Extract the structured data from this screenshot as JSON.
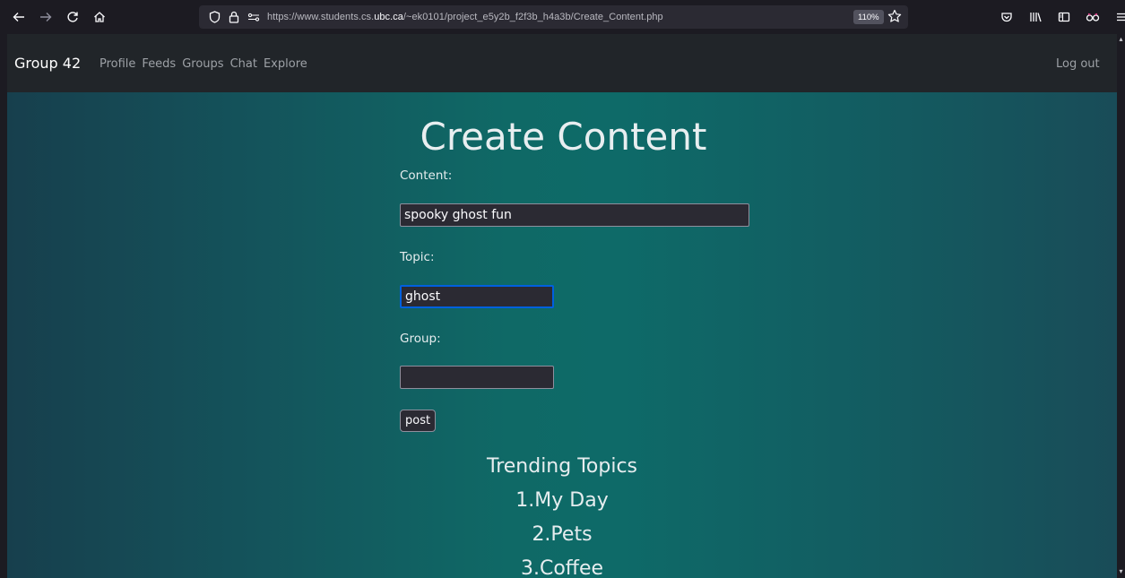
{
  "browser": {
    "url_prefix": "https://www.students.cs.",
    "url_domain": "ubc.ca",
    "url_suffix": "/~ek0101/project_e5y2b_f2f3b_h4a3b/Create_Content.php",
    "zoom": "110%"
  },
  "nav": {
    "brand": "Group 42",
    "links": [
      "Profile",
      "Feeds",
      "Groups",
      "Chat",
      "Explore"
    ],
    "logout": "Log out"
  },
  "page": {
    "title": "Create Content",
    "content_label": "Content:",
    "content_value": "spooky ghost fun",
    "topic_label": "Topic:",
    "topic_value": "ghost",
    "group_label": "Group:",
    "group_value": "",
    "post_label": "post"
  },
  "trending": {
    "heading": "Trending Topics",
    "items": [
      "1.My Day",
      "2.Pets",
      "3.Coffee"
    ]
  }
}
